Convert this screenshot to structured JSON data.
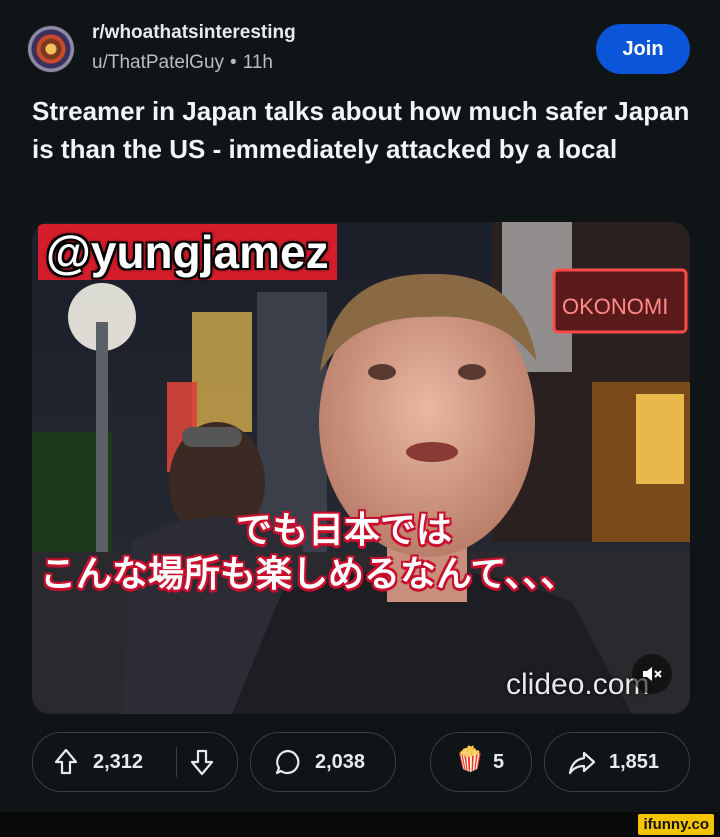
{
  "post": {
    "subreddit": "r/whoathatsinteresting",
    "author": "u/ThatPatelGuy",
    "separator": "•",
    "age": "11h",
    "join_label": "Join",
    "title": "Streamer in Japan talks about how much safer Japan is than the US - immediately attacked by a local"
  },
  "media": {
    "watermark_handle": "@yungjamez",
    "sign_text": "OKONOMI",
    "subtitle_line1": "でも日本では",
    "subtitle_line2": "こんな場所も楽しめるなんて、、、",
    "video_watermark": "clideo.com",
    "mute_icon": "speaker-muted-icon"
  },
  "actions": {
    "upvotes": "2,312",
    "comments": "2,038",
    "awards": "5",
    "shares": "1,851"
  },
  "footer": {
    "brand": "ifunny.co"
  },
  "colors": {
    "background": "#0f1416",
    "join_button": "#0a55d8",
    "pill_border": "#3a4144",
    "subtitle_outline": "#c8102e",
    "watermark_bg": "#d41d2a"
  }
}
